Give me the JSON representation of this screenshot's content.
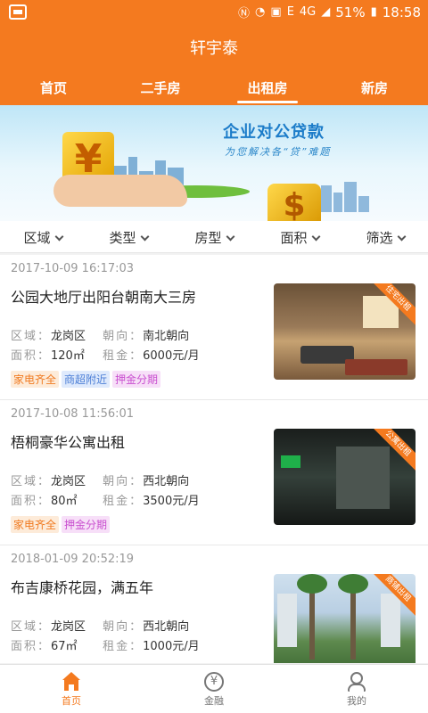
{
  "status_bar": {
    "icons": [
      "notification-icon",
      "nfc-icon",
      "wifi-icon",
      "sim-2-icon",
      "e-network-icon",
      "4g-signal-icon"
    ],
    "network_e": "E",
    "network_4g": "4G",
    "battery": "51%",
    "time": "18:58"
  },
  "header": {
    "title": "轩宇泰",
    "tabs": [
      {
        "label": "首页",
        "active": false
      },
      {
        "label": "二手房",
        "active": false
      },
      {
        "label": "出租房",
        "active": true
      },
      {
        "label": "新房",
        "active": false
      }
    ]
  },
  "banner": {
    "title": "企业对公贷款",
    "subtitle": "为您解决各“贷”难题",
    "yen": "¥",
    "dollar": "$"
  },
  "filters": [
    {
      "label": "区域"
    },
    {
      "label": "类型"
    },
    {
      "label": "房型"
    },
    {
      "label": "面积"
    },
    {
      "label": "筛选"
    }
  ],
  "field_labels": {
    "district": "区域：",
    "orientation": "朝向：",
    "area": "面积：",
    "rent": "租金："
  },
  "listings": [
    {
      "date": "2017-10-09 16:17:03",
      "title": "公园大地厅出阳台朝南大三房",
      "district": "龙岗区",
      "orientation": "南北朝向",
      "area": "120㎡",
      "rent": "6000元/月",
      "tags": [
        {
          "label": "家电齐全",
          "style": "orange"
        },
        {
          "label": "商超附近",
          "style": "blue"
        },
        {
          "label": "押金分期",
          "style": "pink"
        }
      ],
      "ribbon": "住宅出租"
    },
    {
      "date": "2017-10-08 11:56:01",
      "title": "梧桐豪华公寓出租",
      "district": "龙岗区",
      "orientation": "西北朝向",
      "area": "80㎡",
      "rent": "3500元/月",
      "tags": [
        {
          "label": "家电齐全",
          "style": "orange"
        },
        {
          "label": "押金分期",
          "style": "pink"
        }
      ],
      "ribbon": "公寓出租"
    },
    {
      "date": "2018-01-09 20:52:19",
      "title": "布吉康桥花园，满五年",
      "district": "龙岗区",
      "orientation": "西北朝向",
      "area": "67㎡",
      "rent": "1000元/月",
      "tags": [],
      "ribbon": "商铺出租"
    }
  ],
  "bottom_nav": [
    {
      "label": "首页",
      "icon": "home-icon",
      "active": true
    },
    {
      "label": "金融",
      "icon": "yen-coin-icon",
      "active": false
    },
    {
      "label": "我的",
      "icon": "profile-icon",
      "active": false
    }
  ],
  "colors": {
    "brand_orange": "#f47a1f",
    "tag_orange": "#f07a20",
    "tag_blue": "#4c7fd6",
    "tag_pink": "#c94fcf"
  }
}
